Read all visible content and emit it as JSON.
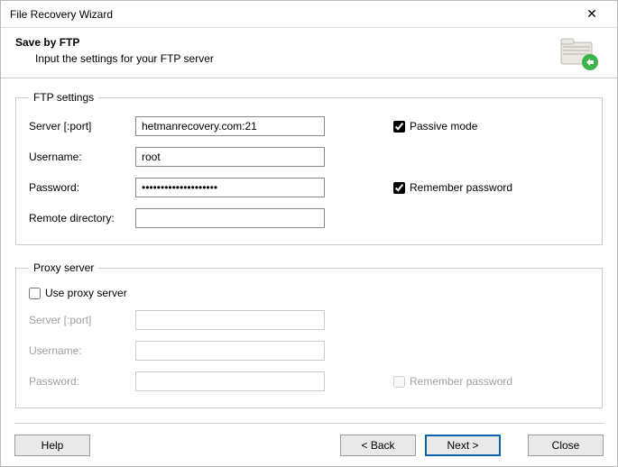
{
  "title": "File Recovery Wizard",
  "header": {
    "title": "Save by FTP",
    "subtitle": "Input the settings for your FTP server"
  },
  "ftp": {
    "legend": "FTP settings",
    "server_label": "Server [:port]",
    "server_value": "hetmanrecovery.com:21",
    "username_label": "Username:",
    "username_value": "root",
    "password_label": "Password:",
    "password_value": "••••••••••••••••••••",
    "remote_dir_label": "Remote directory:",
    "remote_dir_value": "",
    "passive_label": "Passive mode",
    "passive_checked": true,
    "remember_label": "Remember password",
    "remember_checked": true
  },
  "proxy": {
    "legend": "Proxy server",
    "use_proxy_label": "Use proxy server",
    "use_proxy_checked": false,
    "server_label": "Server [:port]",
    "server_value": "",
    "username_label": "Username:",
    "username_value": "",
    "password_label": "Password:",
    "password_value": "",
    "remember_label": "Remember password",
    "remember_checked": false
  },
  "buttons": {
    "help": "Help",
    "back": "< Back",
    "next": "Next >",
    "close": "Close"
  }
}
